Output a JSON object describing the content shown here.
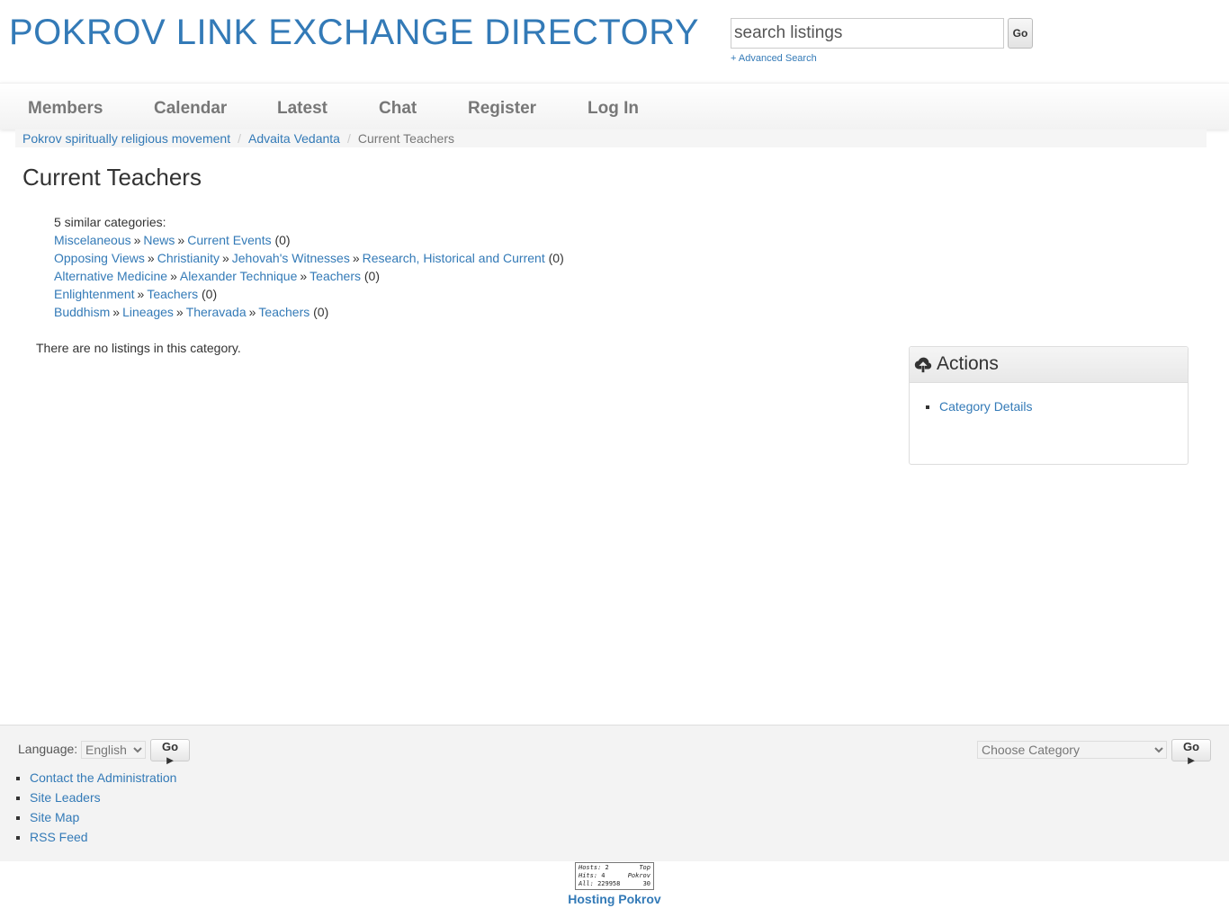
{
  "header": {
    "site_title": "POKROV LINK EXCHANGE DIRECTORY",
    "search_placeholder": "search listings",
    "search_go": "Go",
    "advanced_search": "+ Advanced Search"
  },
  "nav": {
    "items": [
      "Members",
      "Calendar",
      "Latest",
      "Chat",
      "Register",
      "Log In"
    ]
  },
  "breadcrumb": {
    "items": [
      "Pokrov spiritually religious movement",
      "Advaita Vedanta"
    ],
    "current": "Current Teachers",
    "separator": "/"
  },
  "page_title": "Current Teachers",
  "similar": {
    "heading": "5 similar categories:",
    "rows": [
      {
        "links": [
          "Miscelaneous",
          "News",
          "Current Events"
        ],
        "count": "(0)"
      },
      {
        "links": [
          "Opposing Views",
          "Christianity",
          "Jehovah's Witnesses",
          "Research, Historical and Current"
        ],
        "count": "(0)"
      },
      {
        "links": [
          "Alternative Medicine",
          "Alexander Technique",
          "Teachers"
        ],
        "count": "(0)"
      },
      {
        "links": [
          "Enlightenment",
          "Teachers"
        ],
        "count": "(0)"
      },
      {
        "links": [
          "Buddhism",
          "Lineages",
          "Theravada",
          "Teachers"
        ],
        "count": "(0)"
      }
    ],
    "arrow": "»"
  },
  "no_listings": "There are no listings in this category.",
  "actions": {
    "title": "Actions",
    "icon": "cloud-upload-icon",
    "items": [
      "Category Details"
    ]
  },
  "footer": {
    "language_label": "Language:",
    "language_value": "English",
    "category_value": "Choose Category",
    "go_label": "Go ►",
    "links": [
      "Contact the Administration",
      "Site Leaders",
      "Site Map",
      "RSS Feed"
    ]
  },
  "counter": {
    "hosts_label": "Hosts:",
    "hosts": "2",
    "hits_label": "Hits:",
    "hits": "4",
    "all_label": "All:",
    "all": "229958",
    "top_label": "Top",
    "brand": "Pokrov",
    "rank": "30"
  },
  "hosting_link": "Hosting Pokrov",
  "colors": {
    "link": "#337ab7",
    "nav_text": "#777777",
    "footer_bg": "#f3f3f3"
  }
}
